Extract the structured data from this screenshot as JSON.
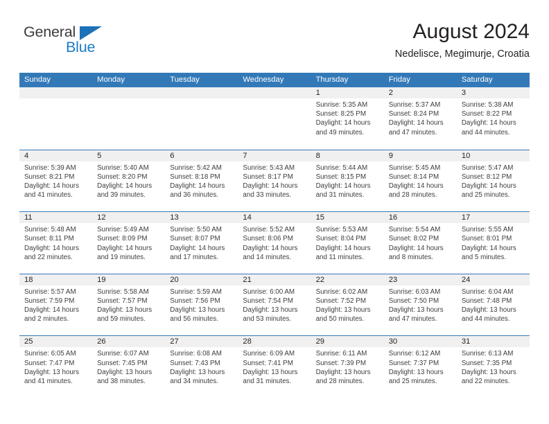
{
  "brand": {
    "name_part1": "General",
    "name_part2": "Blue",
    "triangle_color": "#1c71b8",
    "blue_color": "#1b7bc4"
  },
  "header": {
    "title": "August 2024",
    "subtitle": "Nedelisce, Megimurje, Croatia"
  },
  "theme": {
    "header_bg": "#3379b8",
    "daynum_bg": "#f0f0f0",
    "text": "#231f20"
  },
  "weekdays": [
    "Sunday",
    "Monday",
    "Tuesday",
    "Wednesday",
    "Thursday",
    "Friday",
    "Saturday"
  ],
  "weeks": [
    [
      {
        "day": "",
        "lines": []
      },
      {
        "day": "",
        "lines": []
      },
      {
        "day": "",
        "lines": []
      },
      {
        "day": "",
        "lines": []
      },
      {
        "day": "1",
        "lines": [
          "Sunrise: 5:35 AM",
          "Sunset: 8:25 PM",
          "Daylight: 14 hours",
          "and 49 minutes."
        ]
      },
      {
        "day": "2",
        "lines": [
          "Sunrise: 5:37 AM",
          "Sunset: 8:24 PM",
          "Daylight: 14 hours",
          "and 47 minutes."
        ]
      },
      {
        "day": "3",
        "lines": [
          "Sunrise: 5:38 AM",
          "Sunset: 8:22 PM",
          "Daylight: 14 hours",
          "and 44 minutes."
        ]
      }
    ],
    [
      {
        "day": "4",
        "lines": [
          "Sunrise: 5:39 AM",
          "Sunset: 8:21 PM",
          "Daylight: 14 hours",
          "and 41 minutes."
        ]
      },
      {
        "day": "5",
        "lines": [
          "Sunrise: 5:40 AM",
          "Sunset: 8:20 PM",
          "Daylight: 14 hours",
          "and 39 minutes."
        ]
      },
      {
        "day": "6",
        "lines": [
          "Sunrise: 5:42 AM",
          "Sunset: 8:18 PM",
          "Daylight: 14 hours",
          "and 36 minutes."
        ]
      },
      {
        "day": "7",
        "lines": [
          "Sunrise: 5:43 AM",
          "Sunset: 8:17 PM",
          "Daylight: 14 hours",
          "and 33 minutes."
        ]
      },
      {
        "day": "8",
        "lines": [
          "Sunrise: 5:44 AM",
          "Sunset: 8:15 PM",
          "Daylight: 14 hours",
          "and 31 minutes."
        ]
      },
      {
        "day": "9",
        "lines": [
          "Sunrise: 5:45 AM",
          "Sunset: 8:14 PM",
          "Daylight: 14 hours",
          "and 28 minutes."
        ]
      },
      {
        "day": "10",
        "lines": [
          "Sunrise: 5:47 AM",
          "Sunset: 8:12 PM",
          "Daylight: 14 hours",
          "and 25 minutes."
        ]
      }
    ],
    [
      {
        "day": "11",
        "lines": [
          "Sunrise: 5:48 AM",
          "Sunset: 8:11 PM",
          "Daylight: 14 hours",
          "and 22 minutes."
        ]
      },
      {
        "day": "12",
        "lines": [
          "Sunrise: 5:49 AM",
          "Sunset: 8:09 PM",
          "Daylight: 14 hours",
          "and 19 minutes."
        ]
      },
      {
        "day": "13",
        "lines": [
          "Sunrise: 5:50 AM",
          "Sunset: 8:07 PM",
          "Daylight: 14 hours",
          "and 17 minutes."
        ]
      },
      {
        "day": "14",
        "lines": [
          "Sunrise: 5:52 AM",
          "Sunset: 8:06 PM",
          "Daylight: 14 hours",
          "and 14 minutes."
        ]
      },
      {
        "day": "15",
        "lines": [
          "Sunrise: 5:53 AM",
          "Sunset: 8:04 PM",
          "Daylight: 14 hours",
          "and 11 minutes."
        ]
      },
      {
        "day": "16",
        "lines": [
          "Sunrise: 5:54 AM",
          "Sunset: 8:02 PM",
          "Daylight: 14 hours",
          "and 8 minutes."
        ]
      },
      {
        "day": "17",
        "lines": [
          "Sunrise: 5:55 AM",
          "Sunset: 8:01 PM",
          "Daylight: 14 hours",
          "and 5 minutes."
        ]
      }
    ],
    [
      {
        "day": "18",
        "lines": [
          "Sunrise: 5:57 AM",
          "Sunset: 7:59 PM",
          "Daylight: 14 hours",
          "and 2 minutes."
        ]
      },
      {
        "day": "19",
        "lines": [
          "Sunrise: 5:58 AM",
          "Sunset: 7:57 PM",
          "Daylight: 13 hours",
          "and 59 minutes."
        ]
      },
      {
        "day": "20",
        "lines": [
          "Sunrise: 5:59 AM",
          "Sunset: 7:56 PM",
          "Daylight: 13 hours",
          "and 56 minutes."
        ]
      },
      {
        "day": "21",
        "lines": [
          "Sunrise: 6:00 AM",
          "Sunset: 7:54 PM",
          "Daylight: 13 hours",
          "and 53 minutes."
        ]
      },
      {
        "day": "22",
        "lines": [
          "Sunrise: 6:02 AM",
          "Sunset: 7:52 PM",
          "Daylight: 13 hours",
          "and 50 minutes."
        ]
      },
      {
        "day": "23",
        "lines": [
          "Sunrise: 6:03 AM",
          "Sunset: 7:50 PM",
          "Daylight: 13 hours",
          "and 47 minutes."
        ]
      },
      {
        "day": "24",
        "lines": [
          "Sunrise: 6:04 AM",
          "Sunset: 7:48 PM",
          "Daylight: 13 hours",
          "and 44 minutes."
        ]
      }
    ],
    [
      {
        "day": "25",
        "lines": [
          "Sunrise: 6:05 AM",
          "Sunset: 7:47 PM",
          "Daylight: 13 hours",
          "and 41 minutes."
        ]
      },
      {
        "day": "26",
        "lines": [
          "Sunrise: 6:07 AM",
          "Sunset: 7:45 PM",
          "Daylight: 13 hours",
          "and 38 minutes."
        ]
      },
      {
        "day": "27",
        "lines": [
          "Sunrise: 6:08 AM",
          "Sunset: 7:43 PM",
          "Daylight: 13 hours",
          "and 34 minutes."
        ]
      },
      {
        "day": "28",
        "lines": [
          "Sunrise: 6:09 AM",
          "Sunset: 7:41 PM",
          "Daylight: 13 hours",
          "and 31 minutes."
        ]
      },
      {
        "day": "29",
        "lines": [
          "Sunrise: 6:11 AM",
          "Sunset: 7:39 PM",
          "Daylight: 13 hours",
          "and 28 minutes."
        ]
      },
      {
        "day": "30",
        "lines": [
          "Sunrise: 6:12 AM",
          "Sunset: 7:37 PM",
          "Daylight: 13 hours",
          "and 25 minutes."
        ]
      },
      {
        "day": "31",
        "lines": [
          "Sunrise: 6:13 AM",
          "Sunset: 7:35 PM",
          "Daylight: 13 hours",
          "and 22 minutes."
        ]
      }
    ]
  ]
}
